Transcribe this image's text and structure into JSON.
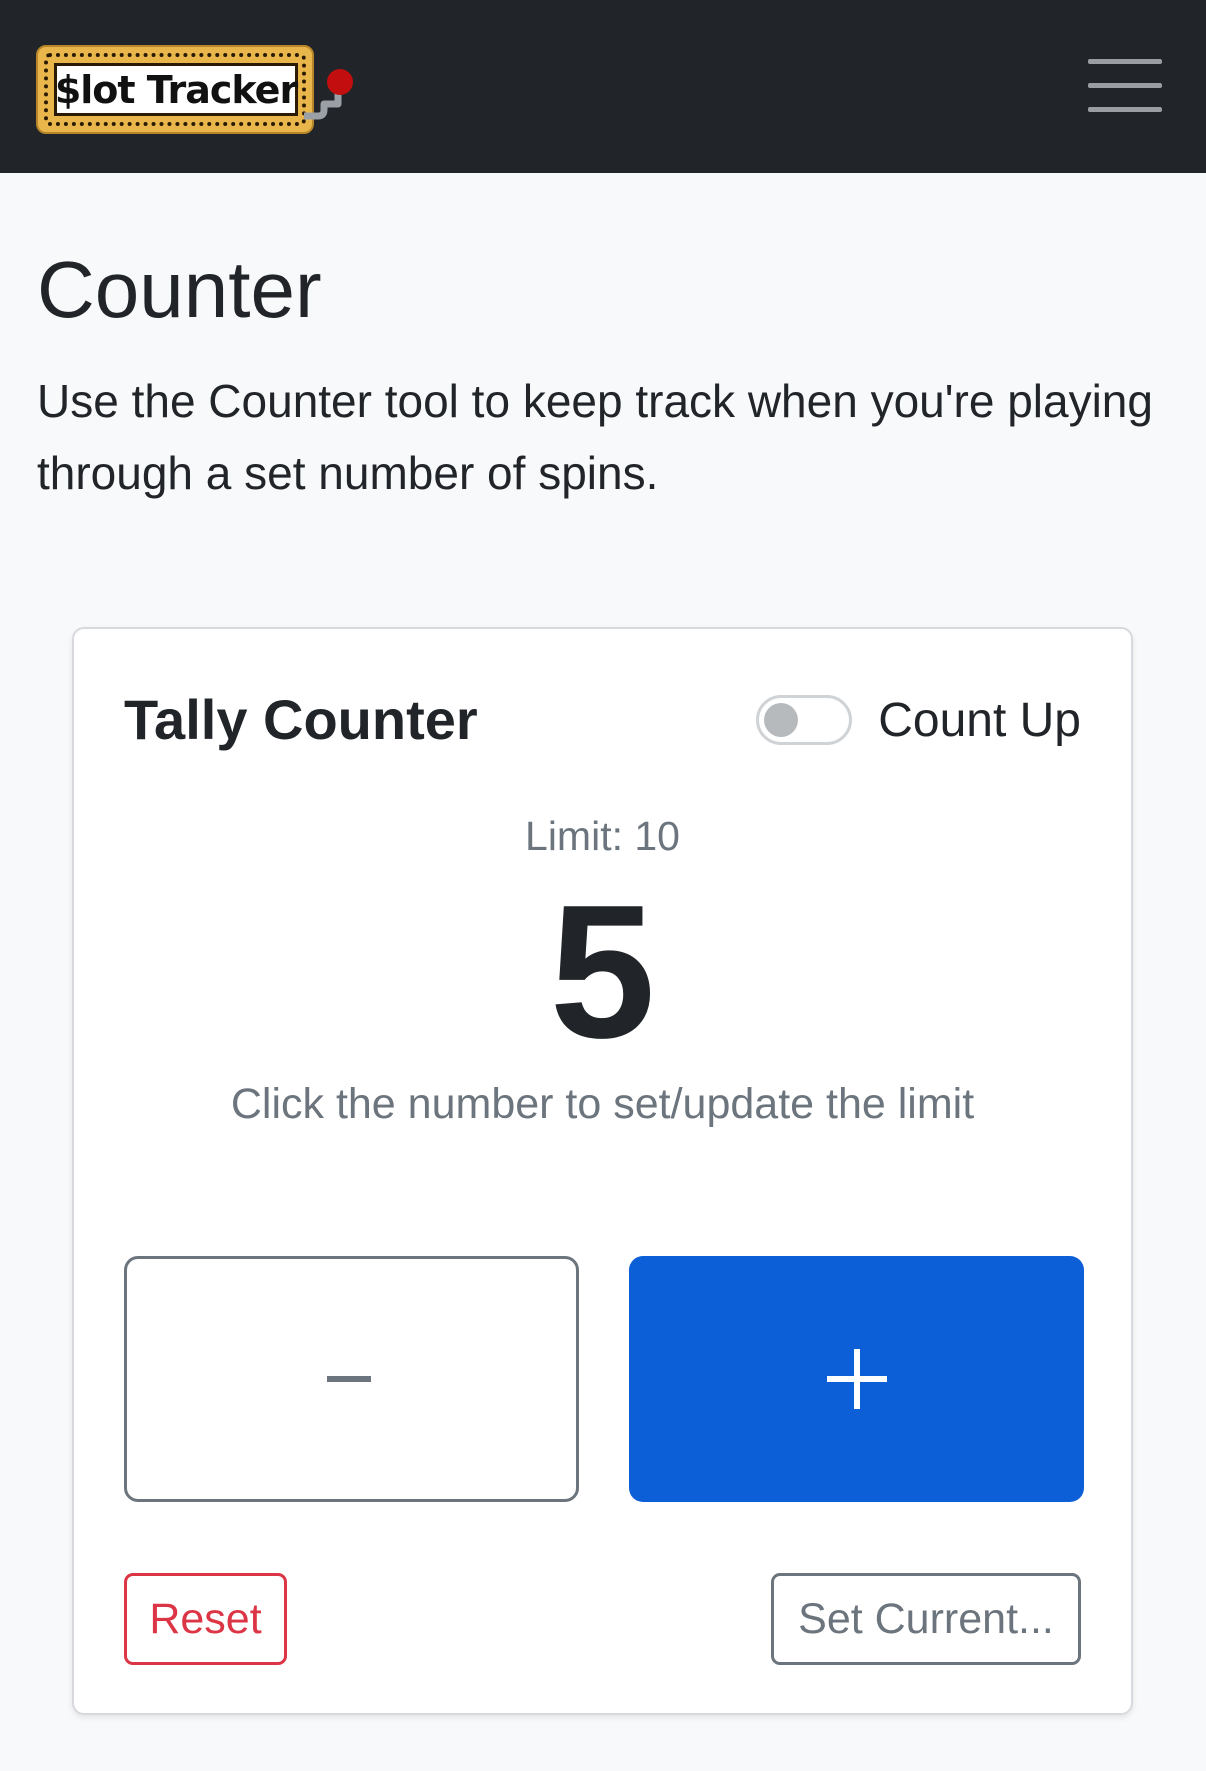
{
  "navbar": {
    "brand_text": "$lot Tracker",
    "colors": {
      "background": "#212529",
      "marquee": "#e8b64a",
      "lever_ball": "#c20e0e"
    }
  },
  "page": {
    "title": "Counter",
    "description": "Use the Counter tool to keep track when you're playing through a set number of spins."
  },
  "tally": {
    "title": "Tally Counter",
    "toggle_label": "Count Up",
    "toggle_on": false,
    "limit_text": "Limit: 10",
    "value": "5",
    "hint": "Click the number to set/update the limit",
    "reset_label": "Reset",
    "set_current_label": "Set Current...",
    "colors": {
      "primary": "#0d5fd8",
      "danger": "#dc3545",
      "secondary": "#6c757d"
    }
  },
  "icons": {
    "menu": "hamburger-menu-icon",
    "minus": "minus-icon",
    "plus": "plus-icon"
  }
}
